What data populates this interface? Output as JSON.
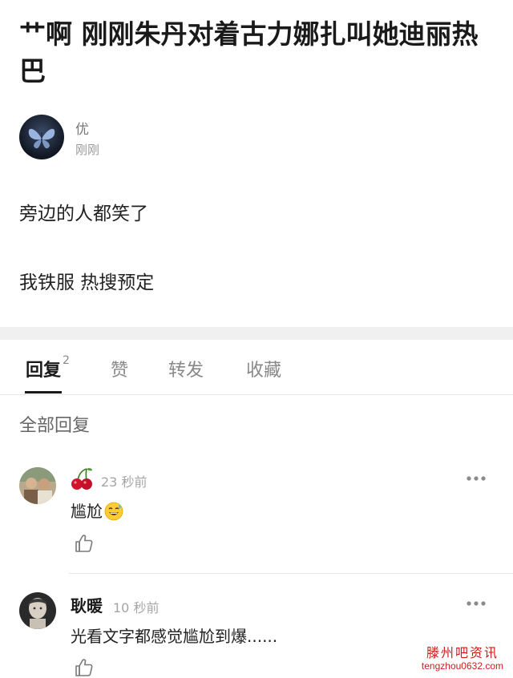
{
  "post": {
    "title": "艹啊 刚刚朱丹对着古力娜扎叫她迪丽热巴",
    "author": {
      "name": "优",
      "time": "刚刚",
      "avatar_icon": "butterfly-avatar"
    },
    "body": [
      "旁边的人都笑了",
      "我铁服 热搜预定"
    ]
  },
  "tabs": {
    "reply_label": "回复",
    "reply_count": "2",
    "like_label": "赞",
    "forward_label": "转发",
    "collect_label": "收藏"
  },
  "replies_header": "全部回复",
  "comments": [
    {
      "author_icon": "cherry-icon",
      "time": "23 秒前",
      "text": "尴尬",
      "emoji_icon": "sweat-smile-emoji"
    },
    {
      "author": "耿暖",
      "time": "10 秒前",
      "text": "光看文字都感觉尴尬到爆......"
    }
  ],
  "watermark": {
    "title": "滕州吧资讯",
    "url": "tengzhou0632.com"
  },
  "colors": {
    "text_primary": "#1a1a1a",
    "text_secondary": "#888888",
    "divider": "#f0f0f0",
    "watermark": "#c81e1e"
  }
}
